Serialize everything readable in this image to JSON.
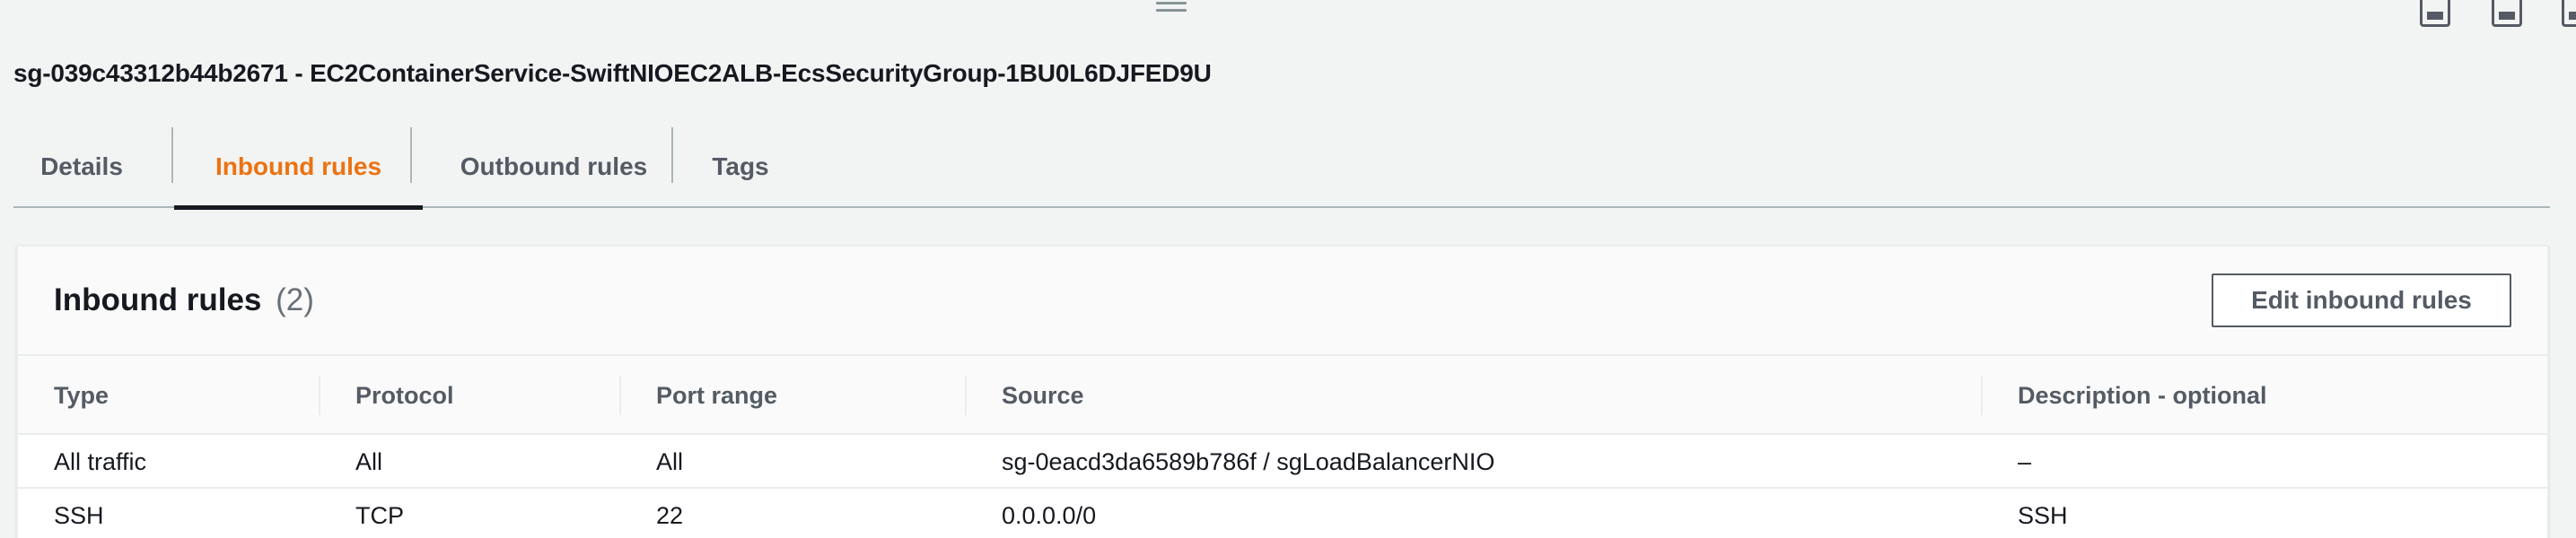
{
  "security_group": {
    "title": "sg-039c43312b44b2671 - EC2ContainerService-SwiftNIOEC2ALB-EcsSecurityGroup-1BU0L6DJFED9U"
  },
  "tabs": [
    {
      "label": "Details"
    },
    {
      "label": "Inbound rules",
      "active": true
    },
    {
      "label": "Outbound rules"
    },
    {
      "label": "Tags"
    }
  ],
  "inbound": {
    "title": "Inbound rules",
    "count": "(2)",
    "edit_button_label": "Edit inbound rules",
    "columns": [
      "Type",
      "Protocol",
      "Port range",
      "Source",
      "Description - optional"
    ],
    "rows": [
      [
        "All traffic",
        "All",
        "All",
        "sg-0eacd3da6589b786f / sgLoadBalancerNIO",
        "–"
      ],
      [
        "SSH",
        "TCP",
        "22",
        "0.0.0.0/0",
        "SSH"
      ]
    ]
  },
  "icons": {
    "drag_handle": "drag-handle-icon",
    "layout": [
      "panel-bottom-icon",
      "panel-bottom-icon",
      "panel-side-icon"
    ]
  },
  "colors": {
    "accent": "#ec7211",
    "background": "#f2f3f3",
    "text": "#16191f",
    "muted": "#545b64"
  }
}
